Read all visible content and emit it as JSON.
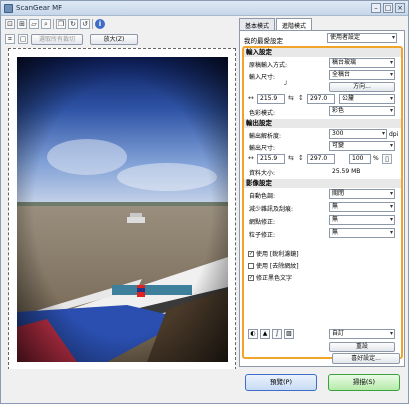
{
  "window": {
    "title": "ScanGear MF"
  },
  "toolbar": {
    "icons": [
      "crop-icon",
      "multi-crop-icon",
      "rotate-icon",
      "zoom-icon",
      "copy-icon",
      "rotate-right-icon",
      "rotate-left-icon",
      "info-icon"
    ],
    "remove_crop_label": "選取所有裁切",
    "zoom_label": "放大(Z)"
  },
  "tabs": [
    {
      "label": "基本模式",
      "active": false
    },
    {
      "label": "進階模式",
      "active": true
    }
  ],
  "favorites": {
    "label": "我的最愛設定",
    "value": "使用者設定"
  },
  "input_settings": {
    "header": "輸入設定",
    "source_label": "原稿輸入方式:",
    "source_value": "稿台玻璃",
    "size_label": "輸入尺寸:",
    "size_value": "全稿台",
    "orientation_value": "方向...",
    "width": "215.9",
    "height": "297.0",
    "unit": "公釐",
    "color_mode_label": "色彩模式:",
    "color_mode_value": "彩色"
  },
  "output_settings": {
    "header": "輸出設定",
    "resolution_label": "輸出解析度:",
    "resolution_value": "300",
    "resolution_unit": "dpi",
    "size_label": "輸出尺寸:",
    "size_value": "可變",
    "width": "215.9",
    "height": "297.0",
    "scale": "100",
    "scale_unit": "%",
    "data_size_label": "資料大小:",
    "data_size_value": "25.59 MB"
  },
  "image_settings": {
    "header": "影像設定",
    "rows": [
      {
        "label": "自動色調:",
        "value": "關閉"
      },
      {
        "label": "減少雜訊及刮痕:",
        "value": "無"
      },
      {
        "label": "網點修正:",
        "value": "無"
      },
      {
        "label": "粒子修正:",
        "value": "無"
      }
    ],
    "checks": [
      {
        "label": "使用 [銳利濾鏡]",
        "checked": true
      },
      {
        "label": "使用 [去除網紋]",
        "checked": false
      },
      {
        "label": "修正黑色文字",
        "checked": true
      }
    ]
  },
  "tone": {
    "icons": [
      "brightness-icon",
      "histogram-icon",
      "tone-curve-icon",
      "threshold-icon"
    ],
    "preset_value": "自訂",
    "reset_label": "重設"
  },
  "preferences_label": "喜好設定...",
  "preview_label": "預覽(P)",
  "scan_label": "掃描(S)",
  "colors": {
    "accent_border": "#f0a52a",
    "preview_btn": "#3f6cc6",
    "scan_btn": "#3aa040"
  }
}
